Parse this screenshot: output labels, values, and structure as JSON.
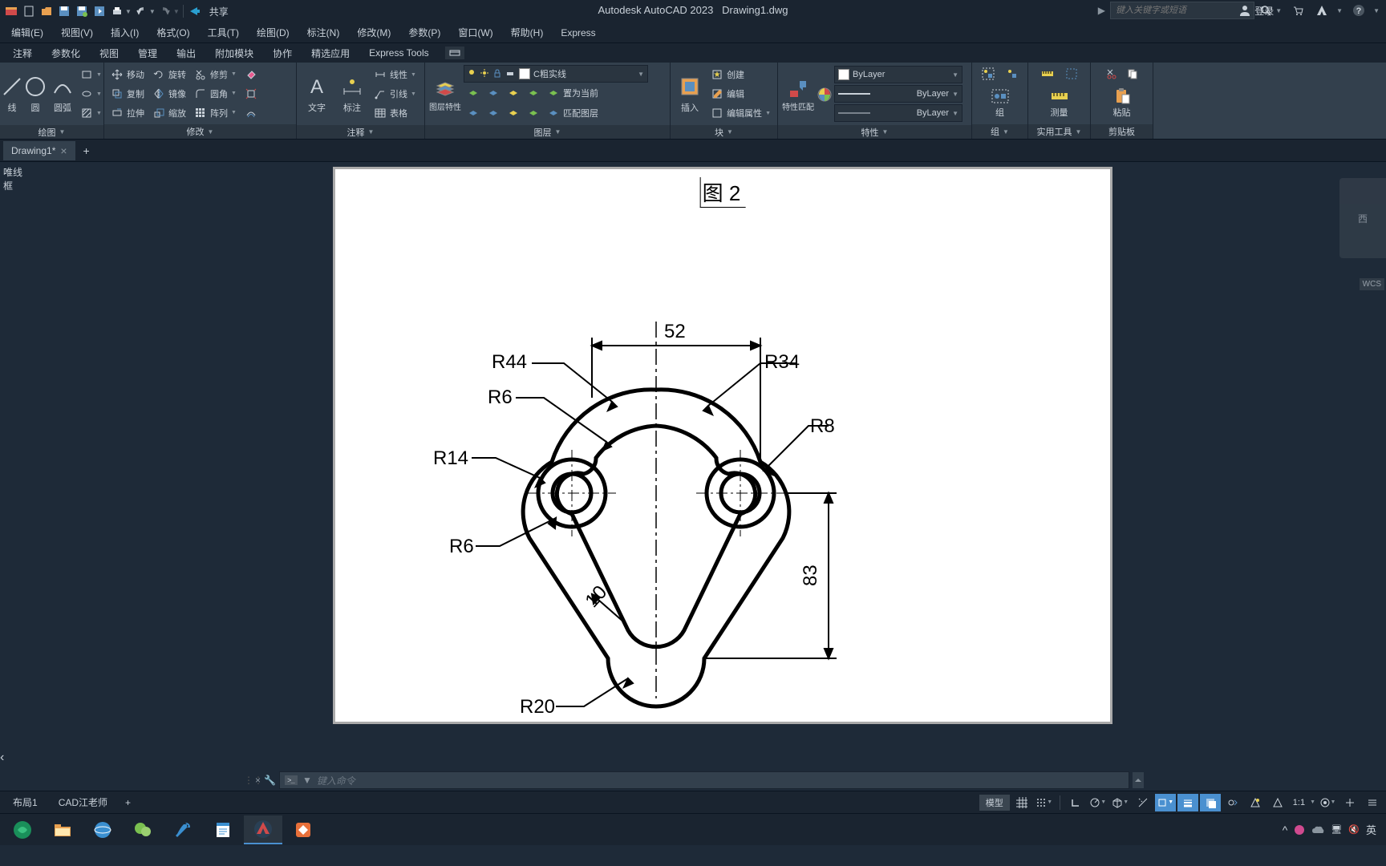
{
  "qat": {
    "share_label": "共享"
  },
  "title": {
    "app": "Autodesk AutoCAD 2023",
    "file": "Drawing1.dwg"
  },
  "search": {
    "placeholder": "键入关键字或短语"
  },
  "login": {
    "label": "登录"
  },
  "menubar": [
    "编辑(E)",
    "视图(V)",
    "插入(I)",
    "格式(O)",
    "工具(T)",
    "绘图(D)",
    "标注(N)",
    "修改(M)",
    "参数(P)",
    "窗口(W)",
    "帮助(H)",
    "Express"
  ],
  "ribbon_tabs": [
    "注释",
    "参数化",
    "视图",
    "管理",
    "输出",
    "附加模块",
    "协作",
    "精选应用",
    "Express Tools"
  ],
  "draw_panel": {
    "line": "线",
    "circle": "圆",
    "arc": "圆弧",
    "title": "绘图"
  },
  "modify_panel": {
    "move": "移动",
    "rotate": "旋转",
    "trim": "修剪",
    "copy": "复制",
    "mirror": "镜像",
    "fillet": "圆角",
    "stretch": "拉伸",
    "scale": "缩放",
    "array": "阵列",
    "title": "修改"
  },
  "annot_panel": {
    "text": "文字",
    "dim": "标注",
    "linear": "线性",
    "leader": "引线",
    "table": "表格",
    "title": "注释"
  },
  "layer_panel": {
    "props": "图层特性",
    "current_layer": "C粗实线",
    "set_current": "置为当前",
    "match": "匹配图层",
    "title": "图层"
  },
  "block_panel": {
    "insert": "插入",
    "create": "创建",
    "edit": "编辑",
    "edit_attr": "编辑属性",
    "title": "块"
  },
  "props_panel": {
    "match": "特性匹配",
    "color": "ByLayer",
    "lweight": "ByLayer",
    "ltype": "ByLayer",
    "title": "特性"
  },
  "group_panel": {
    "group": "组",
    "title": "组"
  },
  "util_panel": {
    "measure": "测量",
    "title": "实用工具"
  },
  "clip_panel": {
    "paste": "粘贴",
    "title": "剪贴板"
  },
  "file_tabs": {
    "tab1": "Drawing1*"
  },
  "sidebar": {
    "label": "唯线框"
  },
  "drawing": {
    "title": "图 2",
    "dims": {
      "d52": "52",
      "r44": "R44",
      "r34": "R34",
      "r6a": "R6",
      "r8": "R8",
      "r14": "R14",
      "r6b": "R6",
      "d10": "10",
      "d83": "83",
      "r20": "R20"
    }
  },
  "viewcube": {
    "face": "西"
  },
  "wcs": "WCS",
  "cmdline": {
    "placeholder": "键入命令"
  },
  "layout_tabs": [
    "布局1",
    "CAD江老师"
  ],
  "status": {
    "model": "模型",
    "scale": "1:1"
  },
  "tray": {
    "ime": "英"
  }
}
